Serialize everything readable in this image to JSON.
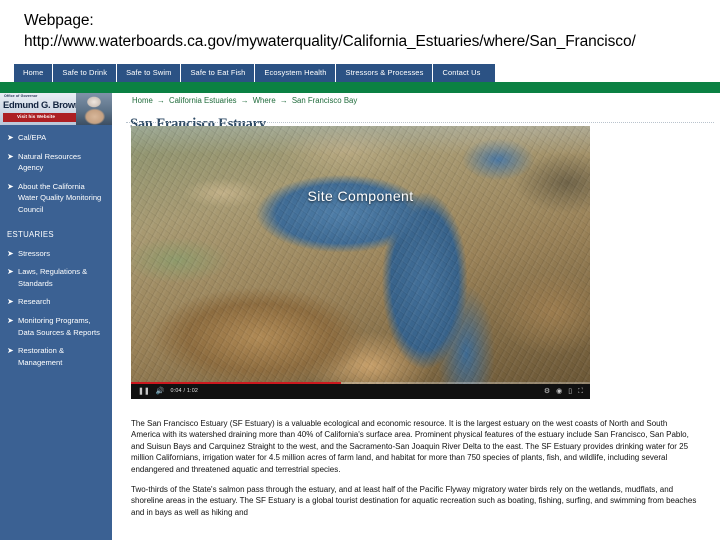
{
  "slide": {
    "url_caption": "Webpage: http://www.waterboards.ca.gov/mywaterquality/California_Estuaries/where/San_Francisco/"
  },
  "colors": {
    "nav_blue": "#2b5284",
    "green_bar": "#0b8143",
    "sidebar_navy": "#3b6193",
    "breadcrumb_green": "#1f6b3b",
    "title_slate": "#2e4a64",
    "progress_red": "#cc181e",
    "gov_banner_red": "#ad1f23"
  },
  "topnav": {
    "items": [
      {
        "label": "Home"
      },
      {
        "label": "Safe to Drink"
      },
      {
        "label": "Safe to Swim"
      },
      {
        "label": "Safe to Eat Fish"
      },
      {
        "label": "Ecosystem Health"
      },
      {
        "label": "Stressors & Processes"
      },
      {
        "label": "Contact Us"
      }
    ]
  },
  "sidebar": {
    "governor_banner": {
      "eyebrow": "Office of Governor",
      "name": "Edmund G. Brown Jr.",
      "visit_label": "Visit his Website"
    },
    "arrow_glyph": "➤",
    "top_links": [
      {
        "label": "Cal/EPA"
      },
      {
        "label": "Natural Resources Agency"
      },
      {
        "label": "About the California Water Quality Monitoring Council"
      }
    ],
    "section_heading": "ESTUARIES",
    "estuary_links": [
      {
        "label": "Stressors"
      },
      {
        "label": "Laws, Regulations & Standards"
      },
      {
        "label": "Research"
      },
      {
        "label": "Monitoring Programs, Data Sources & Reports"
      },
      {
        "label": "Restoration & Management"
      }
    ]
  },
  "content": {
    "breadcrumb": {
      "separator": "→",
      "items": [
        {
          "label": "Home"
        },
        {
          "label": "California Estuaries"
        },
        {
          "label": "Where"
        },
        {
          "label": "San Francisco Bay"
        }
      ]
    },
    "page_title": "San Francisco Estuary",
    "video": {
      "overlay_label": "Site Component",
      "time_display": "0:04 / 1:02",
      "play_pause_icon": "pause-icon",
      "volume_icon": "volume-icon",
      "settings_icon": "gear-icon",
      "captions_icon": "closed-caption-icon",
      "theater_icon": "theater-mode-icon",
      "fullscreen_icon": "fullscreen-icon"
    },
    "paragraphs": [
      "The San Francisco Estuary (SF Estuary) is a valuable ecological and economic resource. It is the largest estuary on the west coasts of North and South America with its watershed draining more than 40% of California's surface area. Prominent physical features of the estuary include San Francisco, San Pablo, and Suisun Bays and Carquinez Straight to the west, and the Sacramento-San Joaquin River Delta to the east. The SF Estuary provides drinking water for 25 million Californians, irrigation water for 4.5 million acres of farm land, and habitat for more than 750 species of plants, fish, and wildlife, including several endangered and threatened aquatic and terrestrial species.",
      "Two-thirds of the State's salmon pass through the estuary, and at least half of the Pacific Flyway migratory water birds rely on the wetlands, mudflats, and shoreline areas in the estuary.  The SF Estuary is a global tourist destination for aquatic recreation such as boating, fishing, surfing, and swimming from beaches and in bays as well as hiking and"
    ]
  }
}
